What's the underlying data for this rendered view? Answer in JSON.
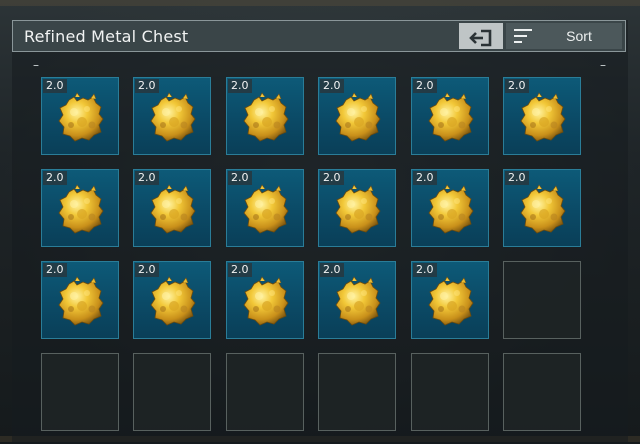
{
  "window": {
    "title": "Refined Metal Chest",
    "sort_label": "Sort",
    "exit_icon": "exit-icon",
    "sort_icon": "sort-lines-icon",
    "collapse_marks": [
      "–",
      "–"
    ]
  },
  "item": {
    "name_icon": "gold-ore-icon",
    "color": "#e0b020"
  },
  "inventory": {
    "columns": 6,
    "rows": 4,
    "slots": [
      {
        "filled": true,
        "quantity": "2.0"
      },
      {
        "filled": true,
        "quantity": "2.0"
      },
      {
        "filled": true,
        "quantity": "2.0"
      },
      {
        "filled": true,
        "quantity": "2.0"
      },
      {
        "filled": true,
        "quantity": "2.0"
      },
      {
        "filled": true,
        "quantity": "2.0"
      },
      {
        "filled": true,
        "quantity": "2.0"
      },
      {
        "filled": true,
        "quantity": "2.0"
      },
      {
        "filled": true,
        "quantity": "2.0"
      },
      {
        "filled": true,
        "quantity": "2.0"
      },
      {
        "filled": true,
        "quantity": "2.0"
      },
      {
        "filled": true,
        "quantity": "2.0"
      },
      {
        "filled": true,
        "quantity": "2.0"
      },
      {
        "filled": true,
        "quantity": "2.0"
      },
      {
        "filled": true,
        "quantity": "2.0"
      },
      {
        "filled": true,
        "quantity": "2.0"
      },
      {
        "filled": true,
        "quantity": "2.0"
      },
      {
        "filled": false
      },
      {
        "filled": false
      },
      {
        "filled": false
      },
      {
        "filled": false
      },
      {
        "filled": false
      },
      {
        "filled": false
      },
      {
        "filled": false
      }
    ]
  }
}
